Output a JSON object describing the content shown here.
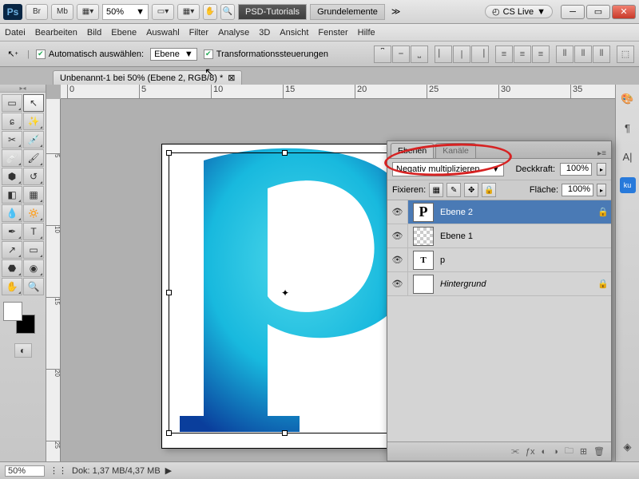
{
  "titlebar": {
    "app_badge": "Ps",
    "buttons": [
      "Br",
      "Mb"
    ],
    "zoom": "50%",
    "seg_dark": "PSD-Tutorials",
    "seg_light": "Grundelemente",
    "cs_live": "CS Live"
  },
  "menu": [
    "Datei",
    "Bearbeiten",
    "Bild",
    "Ebene",
    "Auswahl",
    "Filter",
    "Analyse",
    "3D",
    "Ansicht",
    "Fenster",
    "Hilfe"
  ],
  "options": {
    "auto_select_label": "Automatisch auswählen:",
    "auto_select_target": "Ebene",
    "transform_label": "Transformationssteuerungen"
  },
  "doc_tab": "Unbenannt-1 bei 50% (Ebene 2, RGB/8) *",
  "ruler_h": [
    "0",
    "5",
    "10",
    "15",
    "20",
    "25",
    "30",
    "35"
  ],
  "ruler_v": [
    "5",
    "10",
    "15",
    "20",
    "25"
  ],
  "layers_panel": {
    "tabs": [
      "Ebenen",
      "Kanäle"
    ],
    "blend_mode": "Negativ multiplizieren",
    "opacity_label": "Deckkraft:",
    "opacity_value": "100%",
    "lock_label": "Fixieren:",
    "fill_label": "Fläche:",
    "fill_value": "100%",
    "layers": [
      {
        "name": "Ebene 2",
        "selected": true,
        "thumb": "P",
        "locked": true
      },
      {
        "name": "Ebene 1",
        "thumb": "checker"
      },
      {
        "name": "p",
        "thumb": "T",
        "italic": false
      },
      {
        "name": "Hintergrund",
        "thumb": "white",
        "locked": true,
        "italic": true
      }
    ]
  },
  "status": {
    "zoom": "50%",
    "doc_info": "Dok: 1,37 MB/4,37 MB"
  }
}
